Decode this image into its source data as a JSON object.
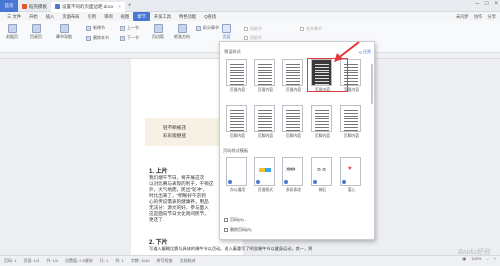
{
  "titlebar": {
    "home": "首页",
    "tabs": [
      {
        "label": "稻壳模板",
        "color": "#e8562a"
      },
      {
        "label": "设置不同的页面边距.docx",
        "color": "#4a77d4"
      }
    ],
    "plus": "+"
  },
  "menubar": {
    "items": [
      "三 文件",
      "开始",
      "插入",
      "页面布局",
      "引用",
      "审阅",
      "视图",
      "章节",
      "开发工具",
      "特色功能"
    ],
    "active": "章节",
    "search": "Q查找",
    "right_items": [
      "未同步",
      "协作",
      "分享"
    ]
  },
  "ribbon": {
    "buttons": [
      "封面页",
      "目录页",
      "章节导航",
      "页边距",
      "纸张方向",
      "页眉页脚"
    ],
    "small": [
      "新增节",
      "删除本节",
      "上一节",
      "下一节",
      "拆分章节",
      "合并章节"
    ],
    "check_items": [
      "同前节",
      "同前节"
    ],
    "page_btn": "页面"
  },
  "document": {
    "banner_lines": [
      "轻不断被违",
      "彩彩能继拯"
    ],
    "h1": "1. 上片",
    "para1": [
      "我们端午节日，将开展这次",
      "以对比赛与表现的利于，干顿这",
      "外，大气地而，民出\"轮冲\"，",
      "时比出来了，\"明晰好午京到",
      "心的传说需表的健康养，用品",
      "无法分：源文的好，参与面入",
      "这是面向节日文化则间民节，",
      "更还了."
    ],
    "h2": "2. 下片",
    "para2": [
      "写道入编略比赛与具体的端午节以活动。说入着重写了明显端午节以健身运动，其一，到"
    ]
  },
  "statusbar": {
    "items": [
      "页码: 1",
      "页面: 1/3",
      "节: 1/4",
      "设置值: 2.5厘米",
      "行: 1",
      "列: 1",
      "字数: 1140",
      "拼写检查",
      "文档校对"
    ],
    "zoom": "100%"
  },
  "dropdown": {
    "section1_title": "预设样式",
    "reset": "还原",
    "row1": [
      "页眉内容",
      "页眉内容",
      "页眉内容",
      "页眉内容",
      "页眉内容"
    ],
    "row2": [
      "页脚内容",
      "页脚内容",
      "页脚内容",
      "页脚内容",
      "页脚内容"
    ],
    "section2_title": "页码样式模板",
    "templates": [
      "办公通用",
      "页眉版式",
      "多彩条纹",
      "梯石",
      "爱心"
    ],
    "links": [
      "页码(N)...",
      "删除页码(R)"
    ]
  },
  "watermark": "Baidu经验",
  "colors": {
    "accent": "#4a77d4",
    "highlight": "#e23a3a"
  }
}
